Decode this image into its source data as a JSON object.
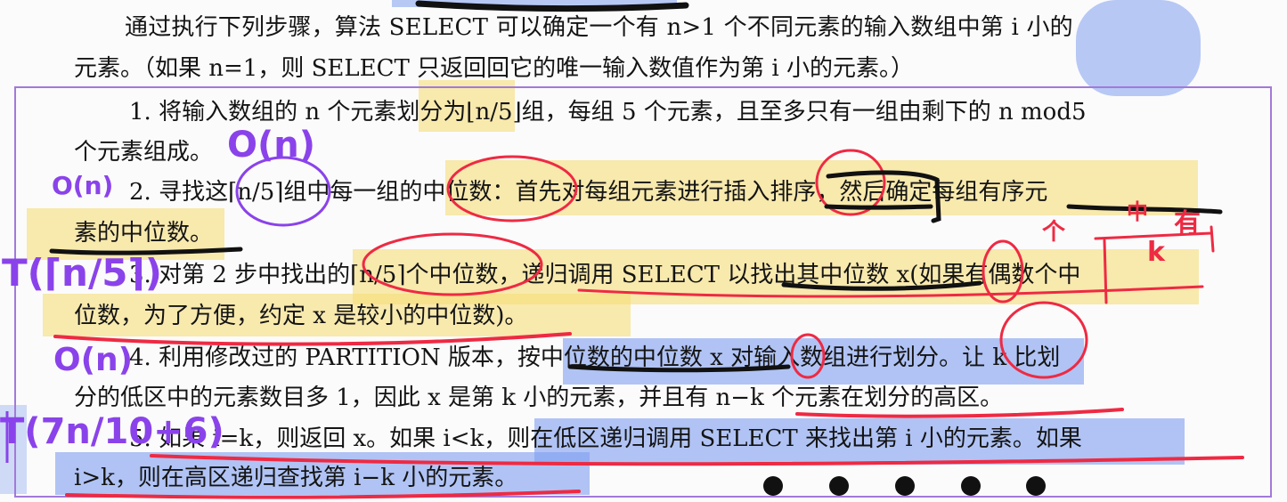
{
  "document": {
    "intro": {
      "line1": "通过执行下列步骤，算法 SELECT 可以确定一个有 n>1 个不同元素的输入数组中第 i 小的",
      "line2": "元素。（如果 n=1，则 SELECT 只返回回它的唯一输入数值作为第 i 小的元素。）"
    },
    "steps": [
      {
        "line1": "1. 将输入数组的 n 个元素划分为⌊n/5⌋组，每组 5 个元素，且至多只有一组由剩下的 n mod5",
        "line2": "个元素组成。"
      },
      {
        "line1": "2. 寻找这⌈n/5⌉组中每一组的中位数：首先对每组元素进行插入排序，然后确定每组有序元",
        "line2": "素的中位数。"
      },
      {
        "line1": "3. 对第 2 步中找出的⌈n/5⌉个中位数，递归调用 SELECT 以找出其中位数 x(如果有偶数个中",
        "line2": "位数，为了方便，约定 x 是较小的中位数)。"
      },
      {
        "line1": "4. 利用修改过的 PARTITION 版本，按中位数的中位数 x 对输入数组进行划分。让 k 比划",
        "line2": "分的低区中的元素数目多 1，因此 x 是第 k 小的元素，并且有 n−k 个元素在划分的高区。"
      },
      {
        "line1": "5. 如果 i=k，则返回 x。如果 i<k，则在低区递归调用 SELECT 来找出第 i 小的元素。如果",
        "line2": "i>k，则在高区递归查找第 i−k 小的元素。"
      }
    ]
  },
  "annotations": {
    "handwritten": [
      "O(n)",
      "O(n)",
      "T(⌈n/5⌉)",
      "O(n)",
      "T(7n/10+6)",
      "个",
      "中",
      "k",
      "有"
    ]
  },
  "colors": {
    "yellow_highlight": "#f6dd7a",
    "blue_highlight": "#7f9ef0",
    "red_ink": "#ee2a43",
    "purple_ink": "#8a43ea",
    "black_ink": "#111111",
    "frame": "#a27ad8"
  }
}
